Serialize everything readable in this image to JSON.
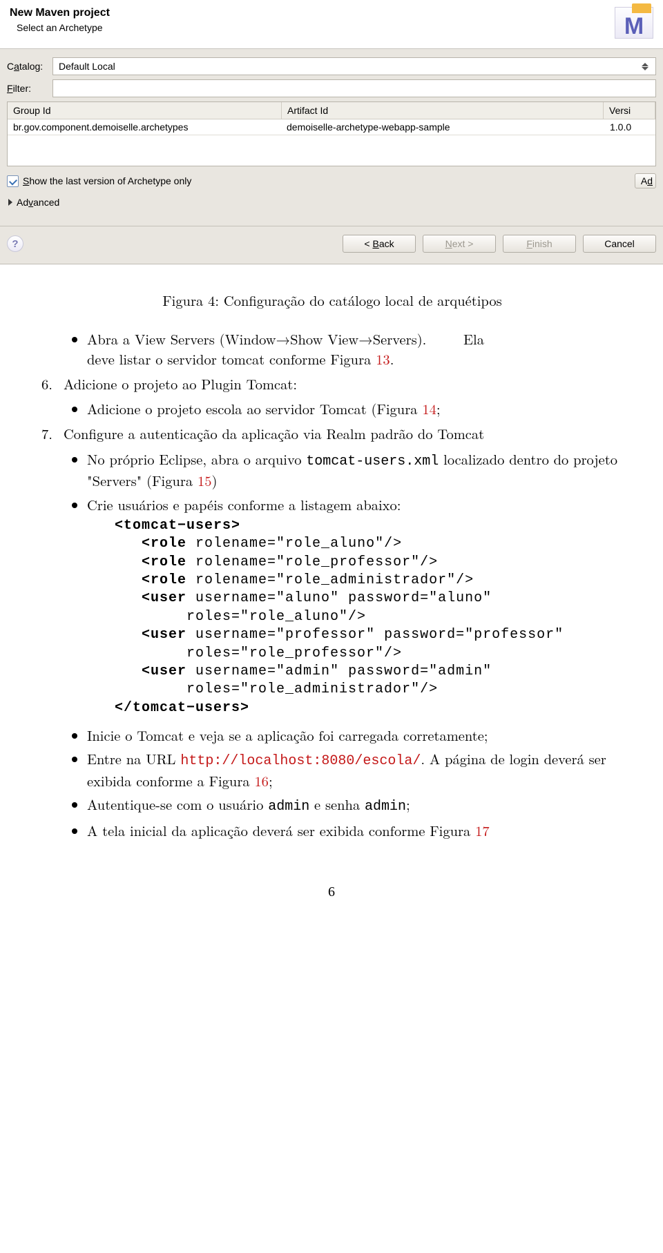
{
  "dialog": {
    "title": "New Maven project",
    "subtitle": "Select an Archetype",
    "logo_letter": "M",
    "catalog_label": "Catalog:",
    "catalog_value": "Default Local",
    "filter_label": "Filter:",
    "filter_value": "",
    "table": {
      "headers": {
        "group": "Group Id",
        "artifact": "Artifact Id",
        "version": "Versi"
      },
      "row": {
        "group": "br.gov.component.demoiselle.archetypes",
        "artifact": "demoiselle-archetype-webapp-sample",
        "version": "1.0.0"
      }
    },
    "checkbox_label": "Show the last version of Archetype only",
    "truncated_button": "Ad",
    "advanced_label": "Advanced",
    "buttons": {
      "back": "< Back",
      "next": "Next >",
      "finish": "Finish",
      "cancel": "Cancel"
    },
    "help": "?"
  },
  "doc": {
    "caption": "Figura 4: Configuração do catálogo local de arquétipos",
    "bullet_servers_a": "Abra a View Servers (Window→Show View→Servers).",
    "bullet_servers_gap": "Ela",
    "bullet_servers_b1": "deve listar o servidor tomcat conforme Figura ",
    "ref13": "13",
    "bullet_servers_b2": ".",
    "step6_num": "6.",
    "step6_text": "Adicione o projeto ao Plugin Tomcat:",
    "bullet_add_a": "Adicione o projeto escola ao servidor Tomcat (Figura ",
    "ref14": "14",
    "bullet_add_b": ";",
    "step7_num": "7.",
    "step7_text": "Configure a autenticação da aplicação via Realm padrão do Tomcat",
    "bullet_eclipse_a": "No próprio Eclipse, abra o arquivo ",
    "tt_tomcat_users": "tomcat-users.xml",
    "bullet_eclipse_b": " localizado dentro do projeto \"Servers\" (Figura ",
    "ref15": "15",
    "bullet_eclipse_c": ")",
    "bullet_crie": "Crie usuários e papéis conforme a listagem abaixo:",
    "bullet_inicie": "Inicie o Tomcat e veja se a aplicação foi carregada corretamente;",
    "bullet_url_a": "Entre na URL ",
    "url": "http://localhost:8080/escola/",
    "bullet_url_b": ". A página de login deverá ser exibida conforme a Figura ",
    "ref16": "16",
    "bullet_url_c": ";",
    "bullet_auth_a": "Autentique-se com o usuário ",
    "tt_admin1": "admin",
    "bullet_auth_b": " e senha ",
    "tt_admin2": "admin",
    "bullet_auth_c": ";",
    "bullet_tela_a": "A tela inicial da aplicação deverá ser exibida conforme Figura ",
    "ref17": "17",
    "code": {
      "l1a": "<tomcat−users>",
      "l2a": "<role",
      "l2b": " rolename=\"role_aluno\"/>",
      "l3a": "<role",
      "l3b": " rolename=\"role_professor\"/>",
      "l4a": "<role",
      "l4b": " rolename=\"role_administrador\"/>",
      "l5a": "<user",
      "l5b": " username=\"aluno\" password=\"aluno\"",
      "l6": "roles=\"role_aluno\"/>",
      "l7a": "<user",
      "l7b": " username=\"professor\" password=\"professor\"",
      "l8": "roles=\"role_professor\"/>",
      "l9a": "<user",
      "l9b": " username=\"admin\" password=\"admin\"",
      "l10": "roles=\"role_administrador\"/>",
      "l11": "</tomcat−users>"
    },
    "page_number": "6"
  }
}
